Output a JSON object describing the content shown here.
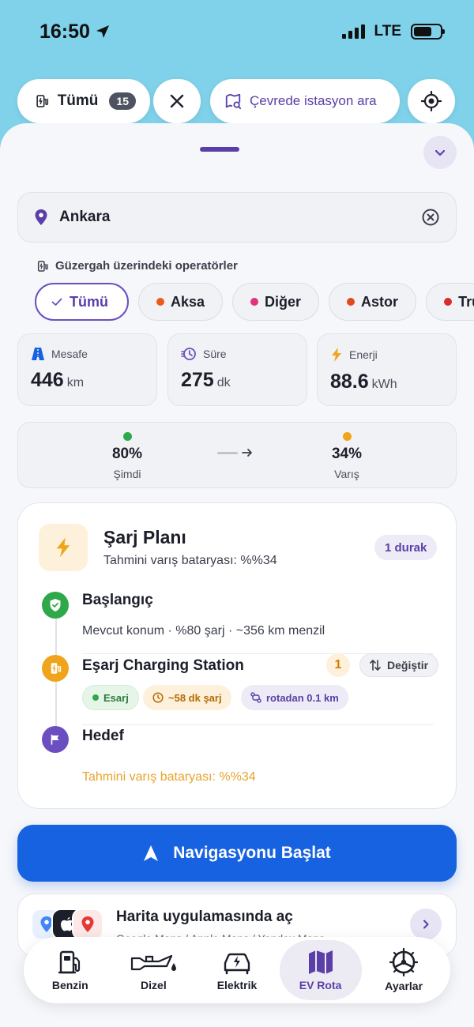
{
  "status_bar": {
    "time": "16:50",
    "network": "LTE"
  },
  "top_bar": {
    "filter_label": "Tümü",
    "filter_count": "15",
    "search_nearby_label": "Çevrede istasyon ara"
  },
  "destination": {
    "value": "Ankara"
  },
  "operators": {
    "section_label": "Güzergah üzerindeki operatörler",
    "items": [
      {
        "label": "Tümü",
        "color": "#6b4fc0"
      },
      {
        "label": "Aksa",
        "color": "#ea5b1b"
      },
      {
        "label": "Diğer",
        "color": "#e0337a"
      },
      {
        "label": "Astor",
        "color": "#e04a1f"
      },
      {
        "label": "Trugo",
        "color": "#d62d2d"
      }
    ]
  },
  "stats": {
    "distance": {
      "label": "Mesafe",
      "value": "446",
      "unit": "km"
    },
    "duration": {
      "label": "Süre",
      "value": "275",
      "unit": "dk"
    },
    "energy": {
      "label": "Enerji",
      "value": "88.6",
      "unit": "kWh"
    }
  },
  "battery": {
    "now": {
      "percent": "80%",
      "label": "Şimdi",
      "color": "#2ea84a"
    },
    "arrival": {
      "percent": "34%",
      "label": "Varış",
      "color": "#f0a41b"
    }
  },
  "charge_plan": {
    "title": "Şarj Planı",
    "subtitle": "Tahmini varış bataryası: %%34",
    "stop_count_label": "1 durak",
    "start": {
      "title": "Başlangıç",
      "description": "Mevcut konum · %80 şarj · ~356 km menzil"
    },
    "station": {
      "title": "Eşarj Charging Station",
      "index": "1",
      "change_label": "Değiştir",
      "operator_tag": "Esarj",
      "time_tag": "~58 dk şarj",
      "distance_tag": "rotadan 0.1 km"
    },
    "destination": {
      "title": "Hedef"
    },
    "footer": "Tahmini varış bataryası: %%34"
  },
  "navigation": {
    "start_label": "Navigasyonu Başlat"
  },
  "map_apps": {
    "title": "Harita uygulamasında aç",
    "subtitle": "Google Maps / Apple Maps / Yandex Maps"
  },
  "tabbar": {
    "active": "EV Rota",
    "items": [
      {
        "label": "Benzin",
        "icon": "fuel-pump-icon"
      },
      {
        "label": "Dizel",
        "icon": "oil-can-icon"
      },
      {
        "label": "Elektrik",
        "icon": "electric-car-icon"
      },
      {
        "label": "EV Rota",
        "icon": "map-icon"
      },
      {
        "label": "Ayarlar",
        "icon": "steering-wheel-icon"
      }
    ]
  },
  "colors": {
    "accent": "#5b3fa8",
    "primary_button": "#1762e0",
    "warning": "#f0a41b",
    "success": "#2ea84a",
    "sky": "#7fd2ea"
  }
}
